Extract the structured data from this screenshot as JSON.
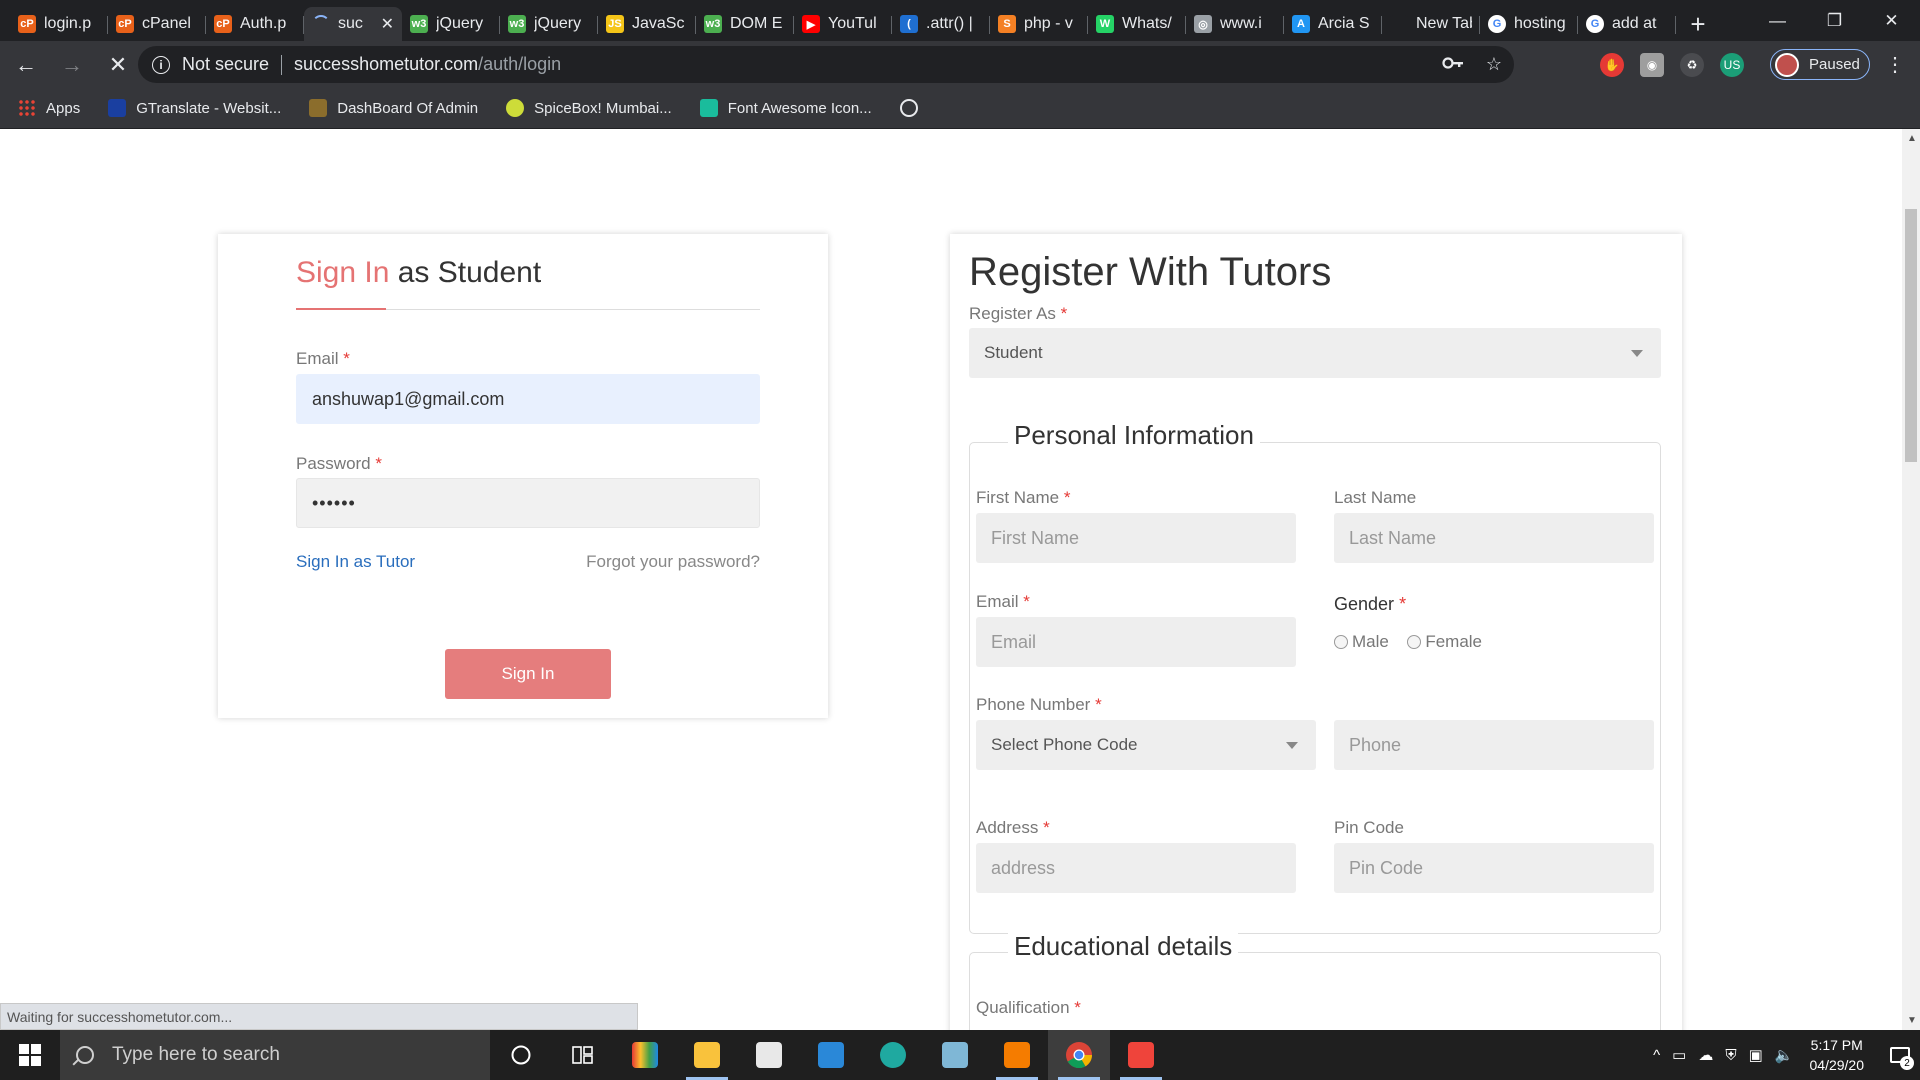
{
  "browser": {
    "tabs": [
      {
        "label": "login.p",
        "fav_color": "#e8611a",
        "fav_text": "cP"
      },
      {
        "label": "cPanel",
        "fav_color": "#e8611a",
        "fav_text": "cP"
      },
      {
        "label": "Auth.p",
        "fav_color": "#e8611a",
        "fav_text": "cP"
      },
      {
        "label": "suc",
        "fav_color": "#35363a",
        "fav_text": "",
        "active": true
      },
      {
        "label": "jQuery",
        "fav_color": "#4caf50",
        "fav_text": "w3"
      },
      {
        "label": "jQuery",
        "fav_color": "#4caf50",
        "fav_text": "w3"
      },
      {
        "label": "JavaSc",
        "fav_color": "#f5c518",
        "fav_text": "JS"
      },
      {
        "label": "DOM E",
        "fav_color": "#4caf50",
        "fav_text": "w3"
      },
      {
        "label": "YouTul",
        "fav_color": "#ff0000",
        "fav_text": "▶"
      },
      {
        "label": ".attr() |",
        "fav_color": "#1f6fd1",
        "fav_text": "("
      },
      {
        "label": "php - v",
        "fav_color": "#f48024",
        "fav_text": "S"
      },
      {
        "label": "Whats/",
        "fav_color": "#25d366",
        "fav_text": "W"
      },
      {
        "label": "www.i",
        "fav_color": "#9aa0a6",
        "fav_text": "◎"
      },
      {
        "label": "Arcia S",
        "fav_color": "#2196f3",
        "fav_text": "A"
      },
      {
        "label": "New Tab",
        "fav_color": "#202124",
        "fav_text": ""
      },
      {
        "label": "hosting",
        "fav_color": "#ffffff",
        "fav_text": "G"
      },
      {
        "label": "add at",
        "fav_color": "#ffffff",
        "fav_text": "G"
      }
    ],
    "active_tab_close": "✕",
    "new_tab": "+",
    "window_controls": {
      "minimize": "—",
      "restore": "❐",
      "close": "✕"
    },
    "nav": {
      "back": "←",
      "forward": "→",
      "stop": "✕"
    },
    "address": {
      "security": "Not secure",
      "host": "successhometutor.com",
      "path": "/auth/login"
    },
    "profile_label": "Paused",
    "bookmarks": [
      {
        "label": "Apps",
        "icon": "apps-grid-icon",
        "color": "#ea4335"
      },
      {
        "label": "GTranslate - Websit...",
        "icon": "gtranslate-icon",
        "color": "#1a3fa0"
      },
      {
        "label": "DashBoard Of Admin",
        "icon": "dashboard-icon",
        "color": "#8b6d2c"
      },
      {
        "label": "SpiceBox! Mumbai...",
        "icon": "spicebox-icon",
        "color": "#cddc39"
      },
      {
        "label": "Font Awesome Icon...",
        "icon": "font-awesome-icon",
        "color": "#1abc9c"
      },
      {
        "label": "",
        "icon": "globe-icon",
        "color": "#e8eaed"
      }
    ],
    "status_text": "Waiting for successhometutor.com..."
  },
  "login": {
    "title_highlight": "Sign In",
    "title_rest": "as Student",
    "email_label": "Email",
    "email_value": "anshuwap1@gmail.com",
    "password_label": "Password",
    "password_value": "••••••",
    "tutor_link": "Sign In as Tutor",
    "forgot_link": "Forgot your password?",
    "submit_label": "Sign In"
  },
  "register": {
    "title": "Register With Tutors",
    "register_as_label": "Register As",
    "register_as_value": "Student",
    "personal_legend": "Personal Information",
    "first_name_label": "First Name",
    "first_name_placeholder": "First Name",
    "last_name_label": "Last Name",
    "last_name_placeholder": "Last Name",
    "email_label": "Email",
    "email_placeholder": "Email",
    "gender_label": "Gender",
    "gender_male": "Male",
    "gender_female": "Female",
    "phone_label": "Phone Number",
    "phone_code_value": "Select Phone Code",
    "phone_placeholder": "Phone",
    "address_label": "Address",
    "address_placeholder": "address",
    "pin_label": "Pin Code",
    "pin_placeholder": "Pin Code",
    "education_legend": "Educational details",
    "qualification_label": "Qualification"
  },
  "taskbar": {
    "search_placeholder": "Type here to search",
    "time": "5:17 PM",
    "date": "04/29/20",
    "notification_count": "2"
  }
}
